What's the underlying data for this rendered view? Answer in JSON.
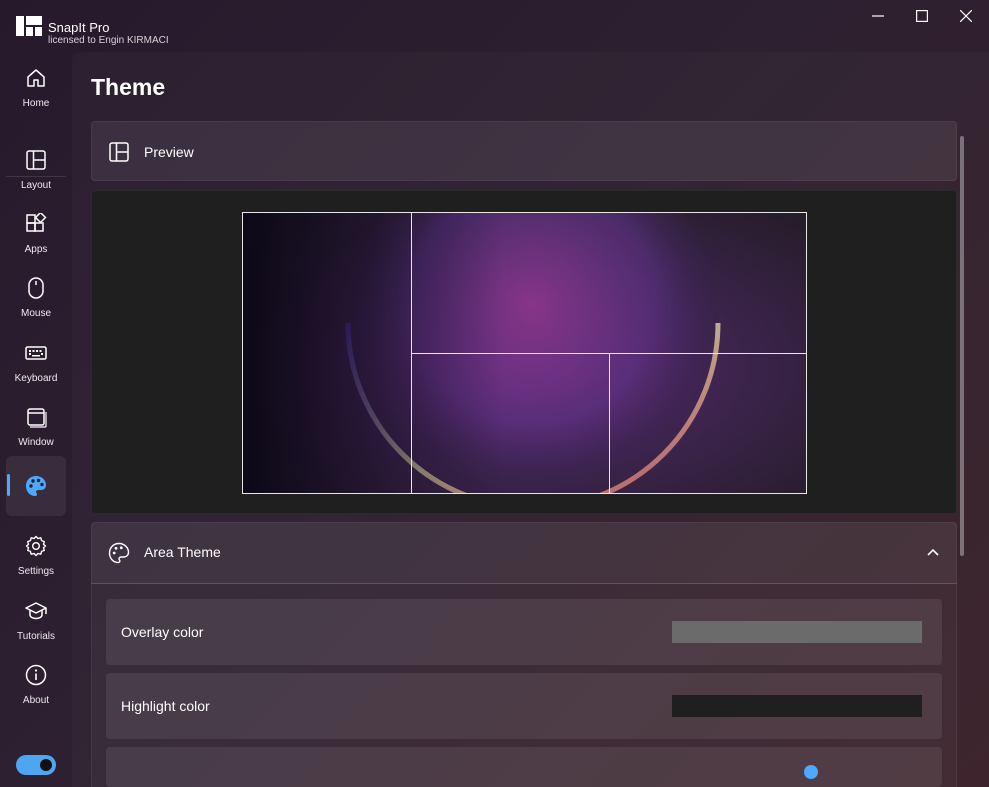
{
  "app": {
    "title": "SnapIt Pro",
    "license": "licensed to Engin KIRMACI"
  },
  "window_controls": [
    "minimize-icon",
    "maximize-icon",
    "close-icon"
  ],
  "sidebar": {
    "items": [
      {
        "label": "Home",
        "icon": "home-icon"
      },
      {
        "label": "Layout",
        "icon": "layout-icon"
      },
      {
        "label": "Apps",
        "icon": "apps-icon"
      },
      {
        "label": "Mouse",
        "icon": "mouse-icon"
      },
      {
        "label": "Keyboard",
        "icon": "keyboard-icon"
      },
      {
        "label": "Window",
        "icon": "window-icon"
      },
      {
        "label": "",
        "icon": "palette-icon",
        "active": true
      },
      {
        "label": "Settings",
        "icon": "gear-icon"
      },
      {
        "label": "Tutorials",
        "icon": "graduation-cap-icon"
      },
      {
        "label": "About",
        "icon": "info-icon"
      }
    ],
    "toggle_on": true
  },
  "page": {
    "title": "Theme",
    "preview": {
      "label": "Preview",
      "icon": "layout-preview-icon"
    },
    "area_theme": {
      "label": "Area Theme",
      "icon": "palette-outline-icon",
      "expanded": true,
      "rows": [
        {
          "label": "Overlay color",
          "color": "#6b6b6b"
        },
        {
          "label": "Highlight color",
          "color": "#1f1f1f"
        }
      ]
    }
  },
  "colors": {
    "accent": "#4da8ff",
    "window_bg": "#2a1f2e"
  }
}
